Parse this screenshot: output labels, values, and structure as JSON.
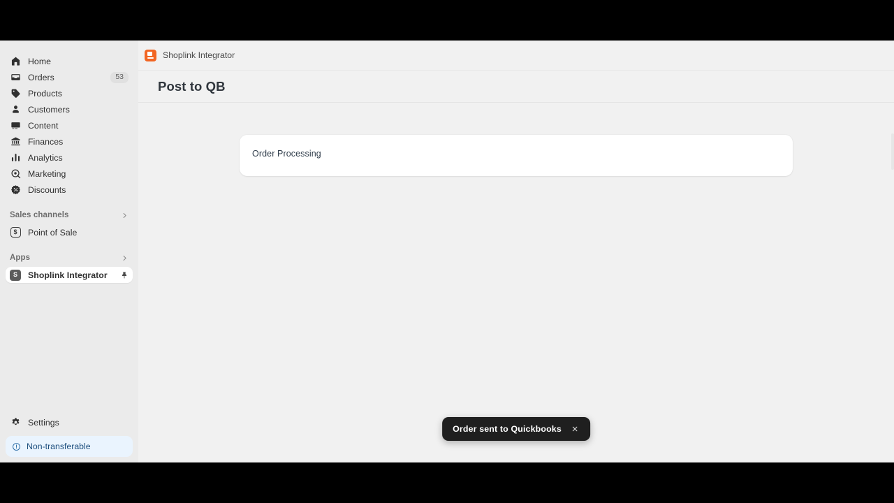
{
  "window": {
    "letterbox_color": "#000000",
    "content_bg": "#f1f1f1",
    "sidebar_bg": "#ebebeb"
  },
  "sidebar": {
    "nav_items": [
      {
        "label": "Home",
        "icon": "home-icon",
        "badge": null,
        "active": false
      },
      {
        "label": "Orders",
        "icon": "orders-icon",
        "badge": "53",
        "active": false
      },
      {
        "label": "Products",
        "icon": "products-icon",
        "badge": null,
        "active": false
      },
      {
        "label": "Customers",
        "icon": "customers-icon",
        "badge": null,
        "active": false
      },
      {
        "label": "Content",
        "icon": "content-icon",
        "badge": null,
        "active": false
      },
      {
        "label": "Finances",
        "icon": "finances-icon",
        "badge": null,
        "active": false
      },
      {
        "label": "Analytics",
        "icon": "analytics-icon",
        "badge": null,
        "active": false
      },
      {
        "label": "Marketing",
        "icon": "marketing-icon",
        "badge": null,
        "active": false
      },
      {
        "label": "Discounts",
        "icon": "discounts-icon",
        "badge": null,
        "active": false
      }
    ],
    "sales_channels": {
      "title": "Sales channels",
      "chevron": "chevron-right-icon",
      "items": [
        {
          "label": "Point of Sale",
          "icon": "point-of-sale-icon",
          "tile_glyph": "$"
        }
      ]
    },
    "apps": {
      "title": "Apps",
      "chevron": "chevron-right-icon",
      "items": [
        {
          "label": "Shoplink Integrator",
          "icon": "app-tile-icon",
          "tile_glyph": "S",
          "pin": "pin-icon",
          "active": true
        }
      ]
    },
    "settings": {
      "label": "Settings",
      "icon": "gear-icon"
    },
    "banner": {
      "label": "Non-transferable",
      "icon": "info-circle-icon",
      "bg_color": "#eaf4fe",
      "text_color": "#1c4e7e"
    }
  },
  "breadcrumb": {
    "app_name": "Shoplink Integrator",
    "icon": "shoplink-app-icon",
    "icon_color": "#f26522"
  },
  "page": {
    "title": "Post to QB"
  },
  "main": {
    "card": {
      "title": "Order Processing"
    }
  },
  "toast": {
    "message": "Order sent to Quickbooks",
    "close_icon": "close-icon",
    "bg_color": "#1f1f1f"
  }
}
